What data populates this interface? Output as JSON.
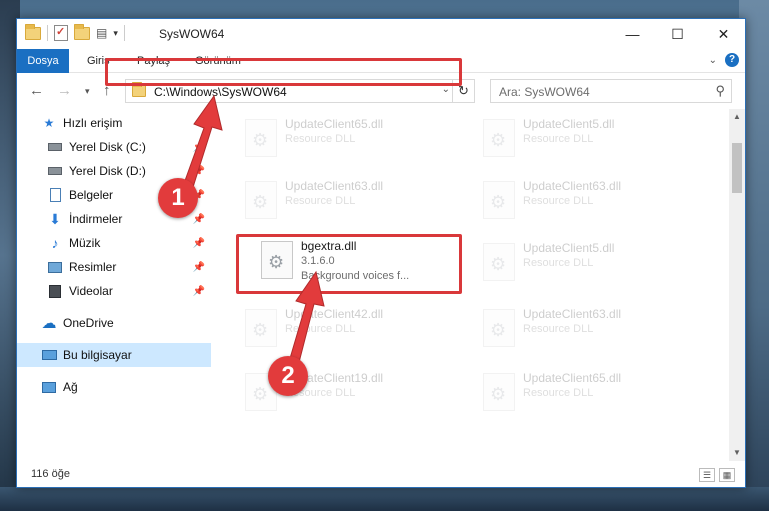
{
  "window": {
    "title": "SysWOW64"
  },
  "window_controls": {
    "minimize": "—",
    "maximize": "☐",
    "close": "✕"
  },
  "ribbon": {
    "tabs": [
      "Dosya",
      "Giriş",
      "Paylaş",
      "Görünüm"
    ]
  },
  "address_bar": {
    "path": "C:\\Windows\\SysWOW64"
  },
  "search": {
    "placeholder": "Ara: SysWOW64"
  },
  "nav_pane": {
    "items": [
      {
        "label": "Hızlı erişim",
        "icon": "star-icon"
      },
      {
        "label": "Yerel Disk (C:)",
        "icon": "drive-icon"
      },
      {
        "label": "Yerel Disk (D:)",
        "icon": "drive-icon"
      },
      {
        "label": "Belgeler",
        "icon": "documents-icon"
      },
      {
        "label": "İndirmeler",
        "icon": "downloads-icon"
      },
      {
        "label": "Müzik",
        "icon": "music-icon"
      },
      {
        "label": "Resimler",
        "icon": "pictures-icon"
      },
      {
        "label": "Videolar",
        "icon": "videos-icon"
      },
      {
        "label": "OneDrive",
        "icon": "cloud-icon"
      },
      {
        "label": "Bu bilgisayar",
        "icon": "computer-icon"
      },
      {
        "label": "Ağ",
        "icon": "network-icon"
      }
    ]
  },
  "files": [
    {
      "name": "UpdateClient65.dll",
      "desc": "Resource DLL"
    },
    {
      "name": "UpdateClient5.dll",
      "desc": "Resource DLL"
    },
    {
      "name": "UpdateClient63.dll",
      "desc": "Resource DLL"
    },
    {
      "name": "UpdateClient63.dll",
      "desc": "Resource DLL"
    },
    {
      "name": "bgextra.dll",
      "version": "3.1.6.0",
      "desc": "Background voices f..."
    },
    {
      "name": "UpdateClient5.dll",
      "desc": "Resource DLL"
    },
    {
      "name": "UpdateClient42.dll",
      "desc": "Resource DLL"
    },
    {
      "name": "UpdateClient63.dll",
      "desc": "Resource DLL"
    },
    {
      "name": "UpdateClient19.dll",
      "desc": "Resource DLL"
    },
    {
      "name": "UpdateClient65.dll",
      "desc": "Resource DLL"
    }
  ],
  "status": {
    "item_count": "116 öğe"
  },
  "annotations": {
    "step1": "1",
    "step2": "2"
  },
  "colors": {
    "accent": "#1a6fc2",
    "highlight": "#d9383a",
    "selected": "#cde8ff"
  }
}
